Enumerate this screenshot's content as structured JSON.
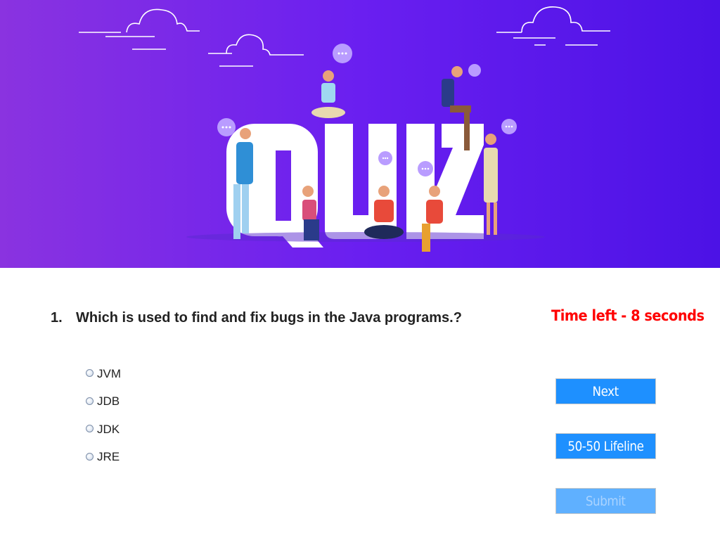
{
  "banner": {
    "title_art": "QUIZ",
    "image": "quiz-people-illustration"
  },
  "question": {
    "number": "1.",
    "text": "Which is used to find and fix bugs in the Java programs.?"
  },
  "timer": {
    "text": "Time left - 8 seconds"
  },
  "options": [
    {
      "label": "JVM"
    },
    {
      "label": "JDB"
    },
    {
      "label": "JDK"
    },
    {
      "label": "JRE"
    }
  ],
  "buttons": {
    "next": "Next",
    "lifeline": "50-50 Lifeline",
    "submit": "Submit"
  },
  "colors": {
    "banner_left": "#8a33e0",
    "banner_right": "#4c12e6",
    "button": "#1e90ff",
    "button_disabled": "#5fb0ff",
    "timer": "#ff0000"
  }
}
